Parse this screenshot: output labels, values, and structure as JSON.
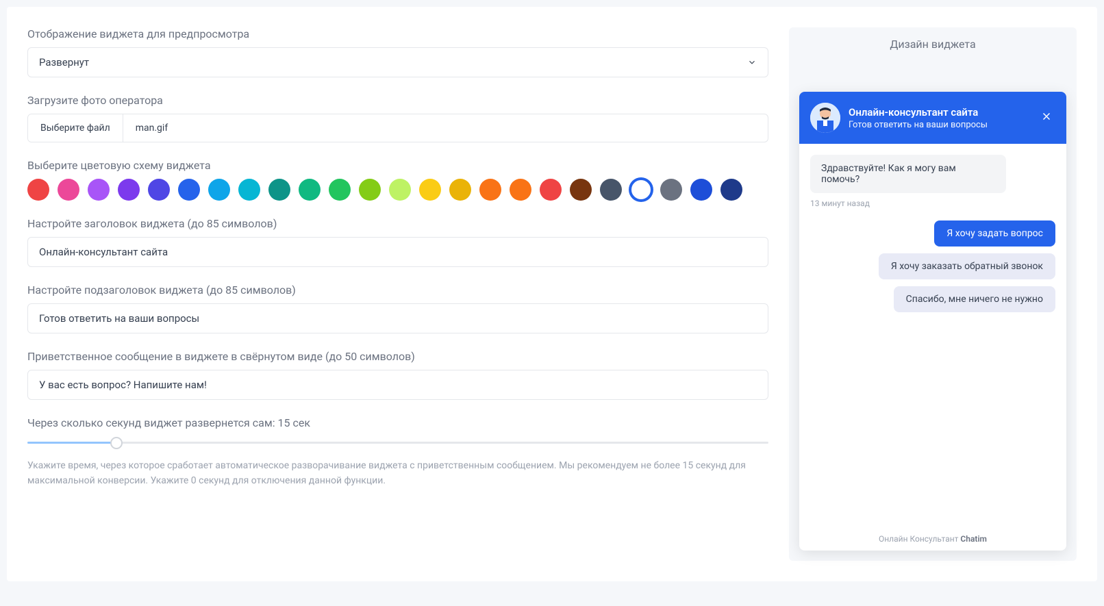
{
  "form": {
    "preview_mode": {
      "label": "Отображение виджета для предпросмотра",
      "value": "Развернут"
    },
    "photo": {
      "label": "Загрузите фото оператора",
      "button": "Выберите файл",
      "filename": "man.gif"
    },
    "color_scheme": {
      "label": "Выберите цветовую схему виджета",
      "colors": [
        "#ef4444",
        "#ec4899",
        "#a855f7",
        "#7c3aed",
        "#4f46e5",
        "#2563eb",
        "#0ea5e9",
        "#06b6d4",
        "#0d9488",
        "#10b981",
        "#22c55e",
        "#84cc16",
        "#bef264",
        "#facc15",
        "#eab308",
        "#f97316",
        "#f97316",
        "#ef4444",
        "#78350f",
        "#475569",
        "#ffffff",
        "#6b7280",
        "#1d4ed8",
        "#1e3a8a"
      ],
      "selected_index": 20
    },
    "title_field": {
      "label": "Настройте заголовок виджета (до 85 символов)",
      "value": "Онлайн-консультант сайта"
    },
    "subtitle_field": {
      "label": "Настройте подзаголовок виджета (до 85 символов)",
      "value": "Готов ответить на ваши вопросы"
    },
    "greeting_field": {
      "label": "Приветственное сообщение в виджете в свёрнутом виде (до 50 символов)",
      "value": "У вас есть вопрос? Напишите нам!"
    },
    "timeout": {
      "label_prefix": "Через сколько секунд виджет развернется сам: ",
      "value": "15 сек",
      "helper": "Укажите время, через которое сработает автоматическое разворачивание виджета с приветственным сообщением. Мы рекомендуем не более 15 секунд для максимальной конверсии. Укажите 0 секунд для отключения данной функции."
    }
  },
  "preview": {
    "title": "Дизайн виджета",
    "chat": {
      "title": "Онлайн-консультант сайта",
      "subtitle": "Готов ответить на ваши вопросы",
      "greeting": "Здравствуйте! Как я могу вам помочь?",
      "time": "13 минут назад",
      "quick_replies": [
        {
          "text": "Я хочу задать вопрос",
          "style": "primary"
        },
        {
          "text": "Я хочу заказать обратный звонок",
          "style": "secondary"
        },
        {
          "text": "Спасибо, мне ничего не нужно",
          "style": "secondary"
        }
      ],
      "footer_prefix": "Онлайн Консультант ",
      "footer_brand": "Chatim"
    }
  }
}
